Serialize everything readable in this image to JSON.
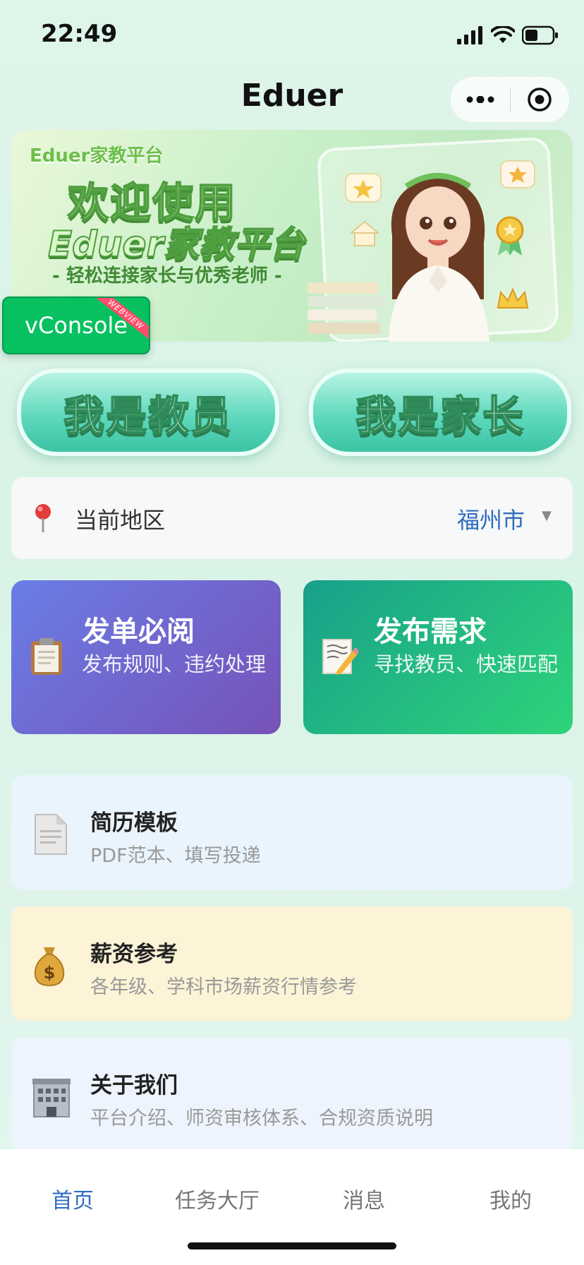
{
  "status_bar": {
    "time": "22:49"
  },
  "nav": {
    "title": "Eduer"
  },
  "banner": {
    "brand": "Eduer家教平台",
    "welcome": "欢迎使用",
    "platform": "Eduer家教平台",
    "slogan": "- 轻松连接家长与优秀老师 -"
  },
  "vconsole": {
    "label": "vConsole",
    "tag": "WEBVIEW"
  },
  "roles": {
    "teacher": "我是教员",
    "parent": "我是家长"
  },
  "region": {
    "label": "当前地区",
    "city": "福州市"
  },
  "features": [
    {
      "title": "发单必阅",
      "desc": "发布规则、违约处理",
      "icon": "clipboard-icon"
    },
    {
      "title": "发布需求",
      "desc": "寻找教员、快速匹配",
      "icon": "memo-icon"
    }
  ],
  "list": [
    {
      "title": "简历模板",
      "sub": "PDF范本、填写投递",
      "icon": "document-icon"
    },
    {
      "title": "薪资参考",
      "sub": "各年级、学科市场薪资行情参考",
      "icon": "money-bag-icon"
    },
    {
      "title": "关于我们",
      "sub": "平台介绍、师资审核体系、合规资质说明",
      "icon": "office-building-icon"
    }
  ],
  "tabbar": {
    "home": "首页",
    "tasks": "任务大厅",
    "messages": "消息",
    "mine": "我的"
  },
  "colors": {
    "accent": "#2f6dbf",
    "vconsole": "#07c160",
    "purple_card": "#6f63d0",
    "green_card": "#21b985"
  }
}
